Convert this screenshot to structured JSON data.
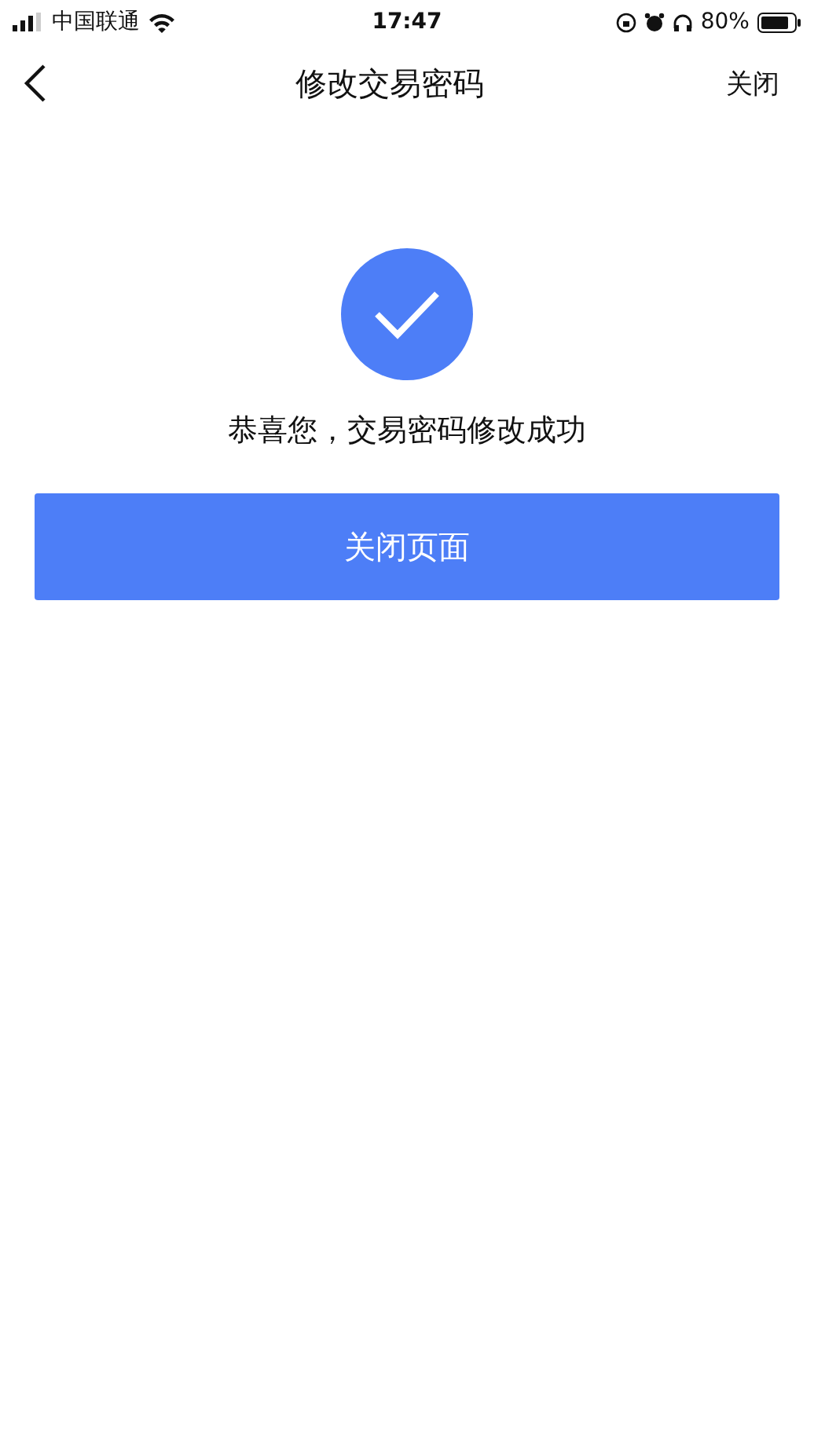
{
  "status_bar": {
    "carrier": "中国联通",
    "time": "17:47",
    "battery": "80%"
  },
  "nav_bar": {
    "title": "修改交易密码",
    "close": "关闭"
  },
  "message": "恭喜您，交易密码修改成功",
  "button": "关闭页面"
}
